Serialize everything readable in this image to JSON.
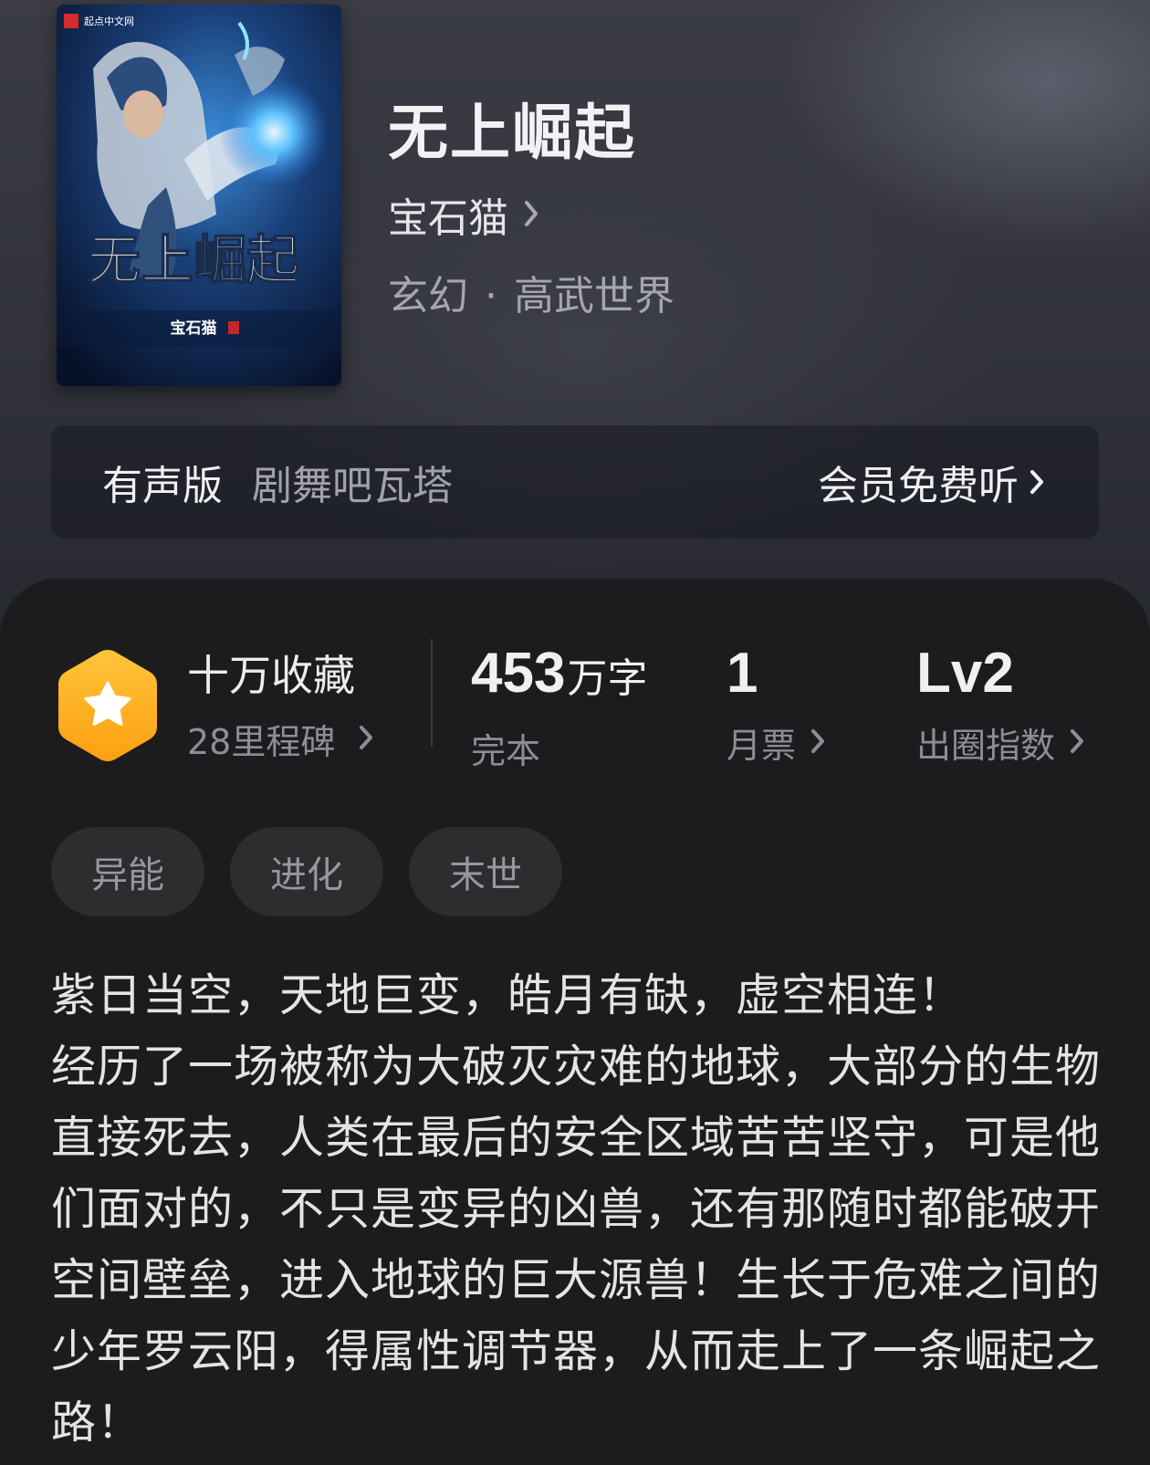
{
  "book": {
    "title": "无上崛起",
    "author": "宝石猫",
    "genre_main": "玄幻",
    "genre_separator": "·",
    "genre_sub": "高武世界"
  },
  "cover": {
    "publisher_logo_text": "起点中文网",
    "title_text": "无上崛起",
    "author_text": "宝石猫"
  },
  "audio": {
    "label": "有声版",
    "narrator": "剧舞吧瓦塔",
    "cta": "会员免费听"
  },
  "stats": {
    "collection_title": "十万收藏",
    "milestones": "28里程碑",
    "word_count_number": "453",
    "word_count_unit": "万字",
    "status": "完本",
    "monthly_tickets_value": "1",
    "monthly_tickets_label": "月票",
    "index_value": "Lv2",
    "index_label": "出圈指数"
  },
  "tags": [
    "异能",
    "进化",
    "末世"
  ],
  "synopsis": [
    "紫日当空，天地巨变，皓月有缺，虚空相连！",
    "经历了一场被称为大破灭灾难的地球，大部分的生物直接死去，人类在最后的安全区域苦苦坚守，可是他们面对的，不只是变异的凶兽，还有那随时都能破开空间壁垒，进入地球的巨大源兽！生长于危难之间的少年罗云阳，得属性调节器，从而走上了一条崛起之路！"
  ],
  "colors": {
    "header_bg": "#35363f",
    "panel_bg": "#1c1c1e",
    "badge_accent": "#ffb21e"
  },
  "icons": {
    "author_chevron": "chevron-right-icon",
    "badge": "star-hexagon-icon"
  }
}
